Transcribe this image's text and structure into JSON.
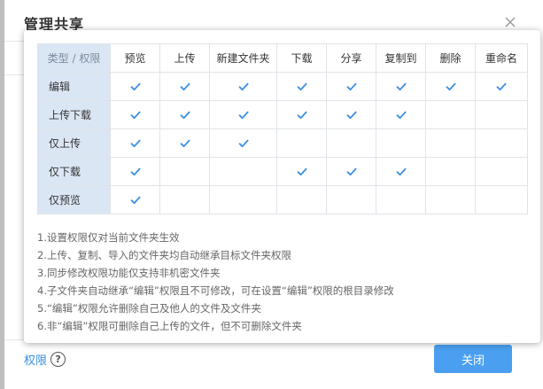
{
  "dialog": {
    "title": "管理共享",
    "permission_link": "权限",
    "help_symbol": "?",
    "close_button": "关闭",
    "accent_color": "#4a9ff0"
  },
  "permissions": {
    "corner_header": "类型 / 权限",
    "columns": [
      "预览",
      "上传",
      "新建文件夹",
      "下载",
      "分享",
      "复制到",
      "删除",
      "重命名"
    ],
    "rows": [
      {
        "label": "编辑",
        "checks": [
          true,
          true,
          true,
          true,
          true,
          true,
          true,
          true
        ]
      },
      {
        "label": "上传下载",
        "checks": [
          true,
          true,
          true,
          true,
          true,
          true,
          false,
          false
        ]
      },
      {
        "label": "仅上传",
        "checks": [
          true,
          true,
          true,
          false,
          false,
          false,
          false,
          false
        ]
      },
      {
        "label": "仅下载",
        "checks": [
          true,
          false,
          false,
          true,
          true,
          true,
          false,
          false
        ]
      },
      {
        "label": "仅预览",
        "checks": [
          true,
          false,
          false,
          false,
          false,
          false,
          false,
          false
        ]
      }
    ],
    "check_color": "#3a8fe3",
    "row_header_bg": "#dbe6f4"
  },
  "notes": [
    "1.设置权限仅对当前文件夹生效",
    "2.上传、复制、导入的文件夹均自动继承目标文件夹权限",
    "3.同步修改权限功能仅支持非机密文件夹",
    "4.子文件夹自动继承“编辑”权限且不可修改，可在设置“编辑”权限的根目录修改",
    "5.“编辑”权限允许删除自己及他人的文件及文件夹",
    "6.非“编辑”权限可删除自己上传的文件，但不可删除文件夹"
  ]
}
